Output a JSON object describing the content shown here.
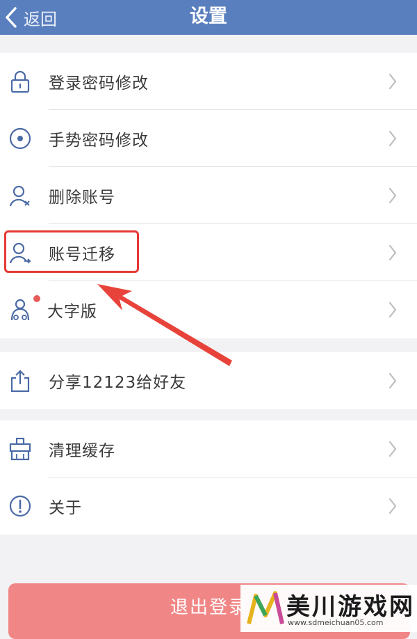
{
  "header": {
    "back_label": "返回",
    "title": "设置"
  },
  "groups": [
    {
      "items": [
        {
          "label": "登录密码修改",
          "icon": "lock-icon"
        },
        {
          "label": "手势密码修改",
          "icon": "gesture-icon"
        },
        {
          "label": "删除账号",
          "icon": "user-delete-icon"
        },
        {
          "label": "账号迁移",
          "icon": "user-transfer-icon",
          "highlighted": true
        },
        {
          "label": "大字版",
          "icon": "elder-mode-icon",
          "badge": "dot"
        }
      ]
    },
    {
      "items": [
        {
          "label": "分享12123给好友",
          "icon": "share-icon"
        }
      ]
    },
    {
      "items": [
        {
          "label": "清理缓存",
          "icon": "broom-icon"
        },
        {
          "label": "关于",
          "icon": "info-icon"
        }
      ]
    }
  ],
  "logout_label": "退出登录",
  "watermark": {
    "title": "美川游戏网",
    "url": "www.sdmeichuan05.com"
  },
  "colors": {
    "navbar": "#5a7fbe",
    "highlight": "#e53935",
    "logout": "#f18686",
    "badge": "#e85c5c",
    "icon": "#4a6aa5"
  }
}
